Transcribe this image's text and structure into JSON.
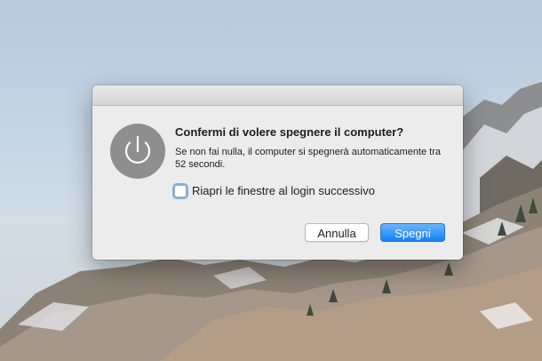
{
  "dialog": {
    "icon": "power-icon",
    "heading": "Confermi di volere spegnere il computer?",
    "message": "Se non fai nulla, il computer si spegnerà automaticamente tra 52 secondi.",
    "checkbox": {
      "label": "Riapri le finestre al login successivo",
      "checked": false
    },
    "buttons": {
      "cancel": "Annulla",
      "confirm": "Spegni"
    },
    "accent_color": "#1480f5"
  }
}
